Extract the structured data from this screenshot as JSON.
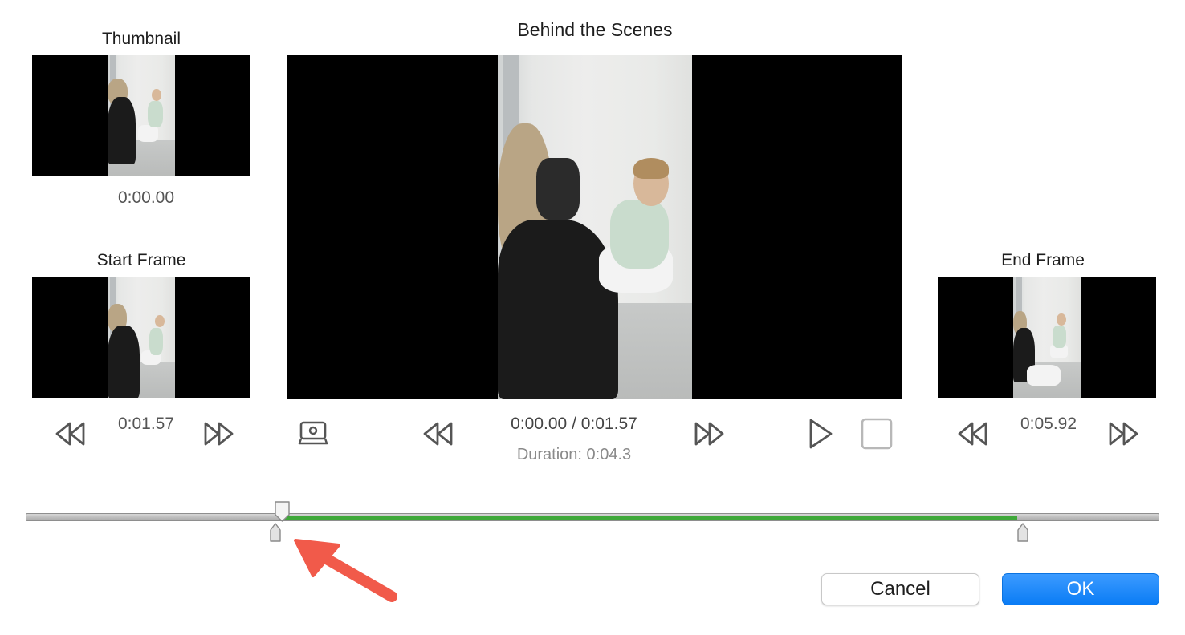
{
  "dialog": {
    "title": "Behind the Scenes",
    "thumbnail": {
      "label": "Thumbnail",
      "time": "0:00.00"
    },
    "start_frame": {
      "label": "Start Frame",
      "time": "0:01.57"
    },
    "end_frame": {
      "label": "End Frame",
      "time": "0:05.92"
    },
    "preview": {
      "position": "0:00.00 / 0:01.57",
      "duration": "Duration: 0:04.3"
    },
    "trim_slider": {
      "start_fraction": 0.226,
      "end_fraction": 0.875
    },
    "buttons": {
      "cancel": "Cancel",
      "ok": "OK"
    }
  },
  "colors": {
    "accent": "#0a7cf5",
    "range": "#3fa83a",
    "annotation_arrow": "#f15a4a"
  },
  "icons": [
    "set-thumbnail-icon",
    "rewind-icon",
    "fast-forward-icon",
    "play-icon",
    "stop-icon"
  ]
}
